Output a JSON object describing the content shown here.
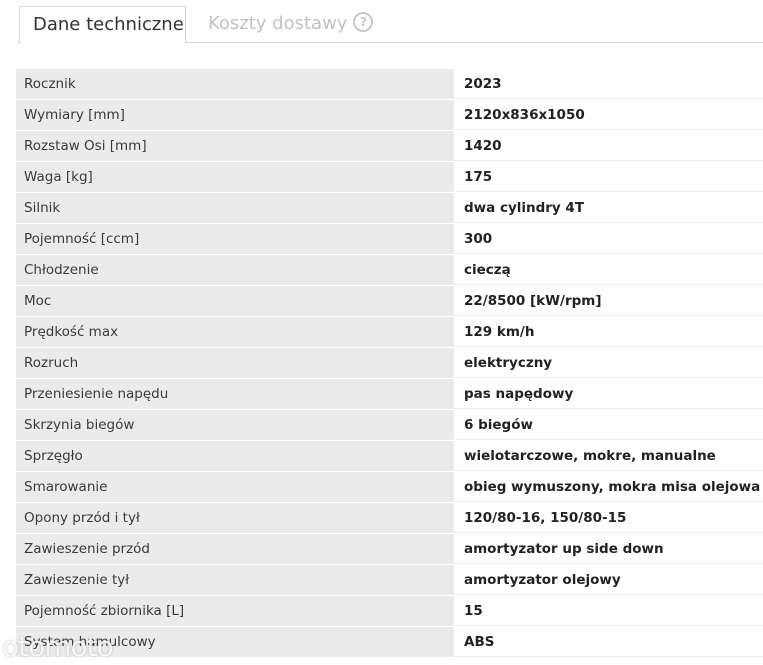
{
  "tabs": [
    {
      "label": "Dane techniczne"
    },
    {
      "label": "Koszty dostawy",
      "icon": "help-icon"
    }
  ],
  "specs": [
    {
      "label": "Rocznik",
      "value": "2023"
    },
    {
      "label": "Wymiary [mm]",
      "value": "2120x836x1050"
    },
    {
      "label": "Rozstaw Osi [mm]",
      "value": "1420"
    },
    {
      "label": "Waga [kg]",
      "value": "175"
    },
    {
      "label": "Silnik",
      "value": "dwa cylindry 4T"
    },
    {
      "label": "Pojemność [ccm]",
      "value": "300"
    },
    {
      "label": "Chłodzenie",
      "value": "cieczą"
    },
    {
      "label": "Moc",
      "value": "22/8500 [kW/rpm]"
    },
    {
      "label": "Prędkość max",
      "value": "129 km/h"
    },
    {
      "label": "Rozruch",
      "value": "elektryczny"
    },
    {
      "label": "Przeniesienie napędu",
      "value": "pas napędowy"
    },
    {
      "label": "Skrzynia biegów",
      "value": "6 biegów"
    },
    {
      "label": "Sprzęgło",
      "value": "wielotarczowe, mokre, manualne"
    },
    {
      "label": "Smarowanie",
      "value": "obieg wymuszony, mokra misa olejowa"
    },
    {
      "label": "Opony przód i tył",
      "value": "120/80-16, 150/80-15"
    },
    {
      "label": "Zawieszenie przód",
      "value": "amortyzator up side down"
    },
    {
      "label": "Zawieszenie tył",
      "value": "amortyzator olejowy"
    },
    {
      "label": "Pojemność zbiornika [L]",
      "value": "15"
    },
    {
      "label": "System hamulcowy",
      "value": "ABS"
    }
  ],
  "watermark": "otomoto"
}
